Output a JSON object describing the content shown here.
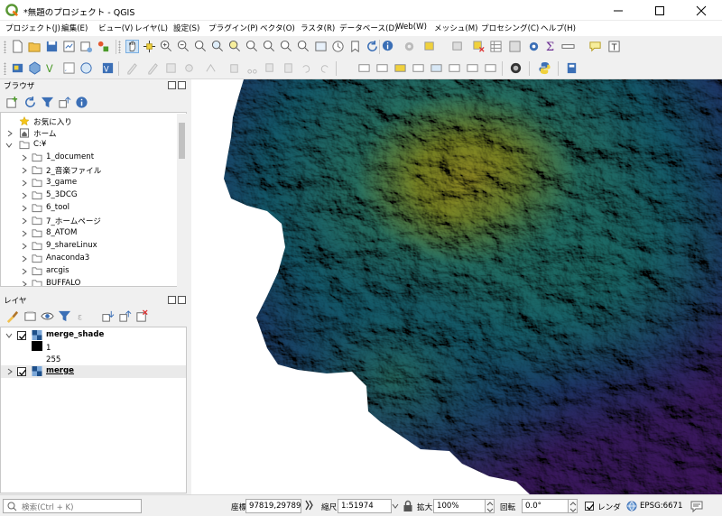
{
  "window": {
    "title": "*無題のプロジェクト - QGIS"
  },
  "menu": [
    "プロジェクト(J)",
    "編集(E)",
    "ビュー(V)",
    "レイヤ(L)",
    "設定(S)",
    "プラグイン(P)",
    "ベクタ(O)",
    "ラスタ(R)",
    "データベース(D)",
    "Web(W)",
    "メッシュ(M)",
    "プロセシング(C)",
    "ヘルプ(H)"
  ],
  "browser": {
    "title": "ブラウザ",
    "items": [
      {
        "label": "お気に入り",
        "icon": "star-icon"
      },
      {
        "label": "ホーム",
        "icon": "home-icon"
      },
      {
        "label": "C:¥",
        "icon": "drive-icon"
      },
      {
        "label": "1_document",
        "icon": "folder-icon"
      },
      {
        "label": "2_音楽ファイル",
        "icon": "folder-icon"
      },
      {
        "label": "3_game",
        "icon": "folder-icon"
      },
      {
        "label": "5_3DCG",
        "icon": "folder-icon"
      },
      {
        "label": "6_tool",
        "icon": "folder-icon"
      },
      {
        "label": "7_ホームページ",
        "icon": "folder-icon"
      },
      {
        "label": "8_ATOM",
        "icon": "folder-icon"
      },
      {
        "label": "9_shareLinux",
        "icon": "folder-icon"
      },
      {
        "label": "Anaconda3",
        "icon": "folder-icon"
      },
      {
        "label": "arcgis",
        "icon": "folder-icon"
      },
      {
        "label": "BUFFALO",
        "icon": "folder-icon"
      }
    ]
  },
  "layers": {
    "title": "レイヤ",
    "items": [
      {
        "name": "merge_shade",
        "legend_min": "1",
        "legend_max": "255"
      },
      {
        "name": "merge"
      }
    ]
  },
  "status": {
    "search_placeholder": "検索(Ctrl + K)",
    "coord_label": "座標",
    "coord_value": "97819,29789",
    "scale_label": "縮尺",
    "scale_value": "1:51974",
    "zoom_label": "拡大",
    "zoom_value": "100%",
    "rotation_label": "回転",
    "rotation_value": "0.0°",
    "render_label": "レンダ",
    "crs": "EPSG:6671"
  },
  "colors": {
    "accent": "#589632",
    "elev_low": "#3d0b6f",
    "elev_mid": "#1fa0a8",
    "elev_high": "#f0e63a"
  }
}
